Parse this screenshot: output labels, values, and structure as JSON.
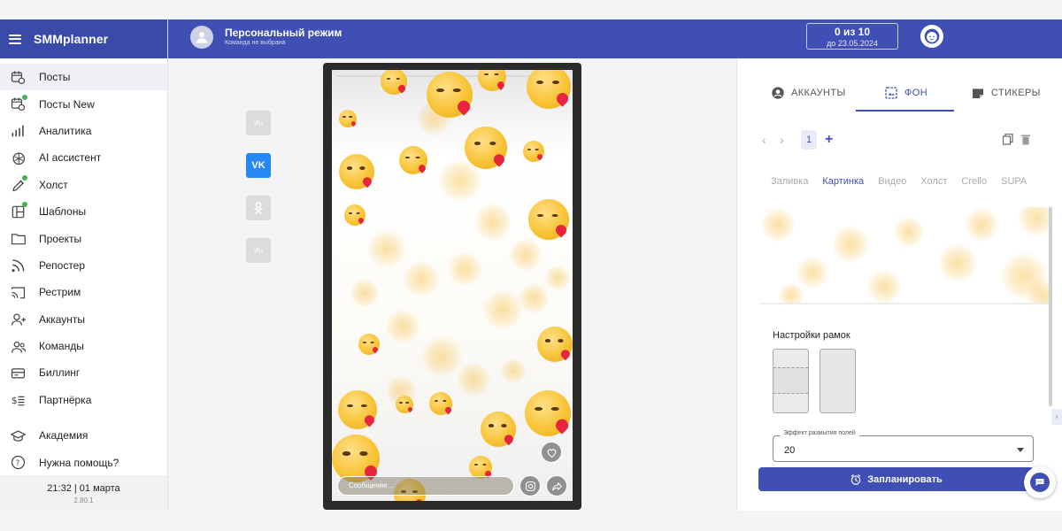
{
  "app": {
    "brand": "SMMplanner"
  },
  "sidebar": {
    "items": [
      {
        "label": "Посты",
        "icon": "calendar-clock-icon",
        "active": true,
        "dot": false
      },
      {
        "label": "Посты New",
        "icon": "calendar-new-icon",
        "active": false,
        "dot": true
      },
      {
        "label": "Аналитика",
        "icon": "bar-chart-icon",
        "active": false,
        "dot": false
      },
      {
        "label": "AI ассистент",
        "icon": "ai-knot-icon",
        "active": false,
        "dot": false
      },
      {
        "label": "Холст",
        "icon": "brush-icon",
        "active": false,
        "dot": true
      },
      {
        "label": "Шаблоны",
        "icon": "template-icon",
        "active": false,
        "dot": true
      },
      {
        "label": "Проекты",
        "icon": "folder-icon",
        "active": false,
        "dot": false
      },
      {
        "label": "Репостер",
        "icon": "rss-icon",
        "active": false,
        "dot": false
      },
      {
        "label": "Рестрим",
        "icon": "cast-icon",
        "active": false,
        "dot": false
      },
      {
        "label": "Аккаунты",
        "icon": "user-plus-icon",
        "active": false,
        "dot": false
      },
      {
        "label": "Команды",
        "icon": "team-icon",
        "active": false,
        "dot": false
      },
      {
        "label": "Биллинг",
        "icon": "card-icon",
        "active": false,
        "dot": false
      },
      {
        "label": "Партнёрка",
        "icon": "dollar-stack-icon",
        "active": false,
        "dot": false
      }
    ],
    "bottom_items": [
      {
        "label": "Академия",
        "icon": "graduation-cap-icon"
      },
      {
        "label": "Нужна помощь?",
        "icon": "help-circle-icon"
      }
    ],
    "clock": "21:32  |  01 марта",
    "version": "2.80.1"
  },
  "topbar": {
    "mode_title": "Персональный режим",
    "mode_subtitle": "Команда не выбрана",
    "quota_main": "0 из 10",
    "quota_sub": "до 23.05.2024"
  },
  "social": {
    "btn1": "Ин",
    "btn2": "VK",
    "btn4": "Ин"
  },
  "story": {
    "progress": 0.0,
    "message_placeholder": "Сообщение..."
  },
  "panel": {
    "tabs": [
      "АККАУНТЫ",
      "ФОН",
      "СТИКЕРЫ"
    ],
    "active_tab": "ФОН",
    "page_number": "1",
    "subtabs": [
      "Заливка",
      "Картинка",
      "Видео",
      "Холст",
      "Crello",
      "SUPA"
    ],
    "active_subtab": "Картинка",
    "frames_title": "Настройки рамок",
    "blur_label": "Эффект размытия полей",
    "blur_value": "20",
    "schedule_label": "Запланировать"
  },
  "colors": {
    "primary": "#3f4fb4",
    "brand_bar": "#3a4aa8",
    "vk": "#2787f5",
    "badge_dot": "#3fb34f"
  }
}
